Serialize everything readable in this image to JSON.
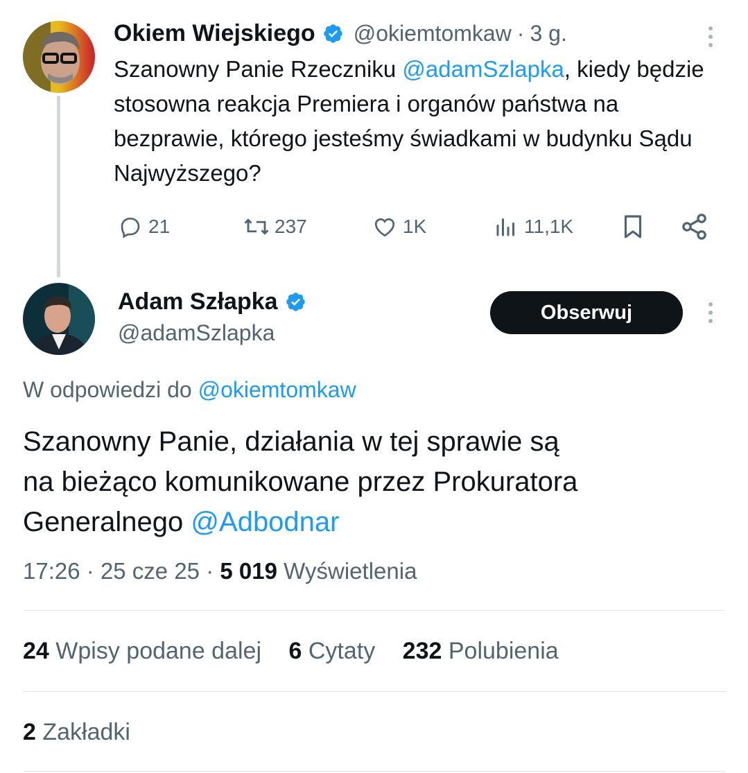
{
  "parent_tweet": {
    "author_name": "Okiem Wiejskiego",
    "handle": "@okiemtomkaw",
    "separator": "·",
    "time": "3 g.",
    "text_before": "Szanowny Panie Rzeczniku ",
    "mention": "@adamSzlapka",
    "text_after": ", kiedy będzie stosowna reakcja Premiera i organów państwa na bezprawie, którego jesteśmy świadkami w budynku Sądu Najwyższego?",
    "replies": "21",
    "retweets": "237",
    "likes": "1K",
    "views": "11,1K"
  },
  "main_tweet": {
    "author_name": "Adam Szłapka",
    "handle": "@adamSzlapka",
    "follow_label": "Obserwuj",
    "reply_to_prefix": "W odpowiedzi do ",
    "reply_to_handle": "@okiemtomkaw",
    "text_line1": "Szanowny Panie, działania w tej sprawie są",
    "text_line2": "na bieżąco komunikowane przez Prokuratora",
    "text_line3": "Generalnego ",
    "text_mention": "@Adbodnar",
    "time": "17:26",
    "date": "25 cze 25",
    "sep": "·",
    "views_count": "5 019",
    "views_label": "Wyświetlenia"
  },
  "stats": {
    "retweets_count": "24",
    "retweets_label": "Wpisy podane dalej",
    "quotes_count": "6",
    "quotes_label": "Cytaty",
    "likes_count": "232",
    "likes_label": "Polubienia",
    "bookmarks_count": "2",
    "bookmarks_label": "Zakładki"
  },
  "colors": {
    "accent": "#1d9bf0",
    "text": "#0f1419",
    "secondary": "#536471",
    "button_bg": "#0f1419",
    "divider": "#e1e8ed"
  },
  "icons": [
    "verified-badge-icon",
    "more-options-icon",
    "reply-icon",
    "retweet-icon",
    "like-icon",
    "views-icon",
    "bookmark-icon",
    "share-icon"
  ]
}
